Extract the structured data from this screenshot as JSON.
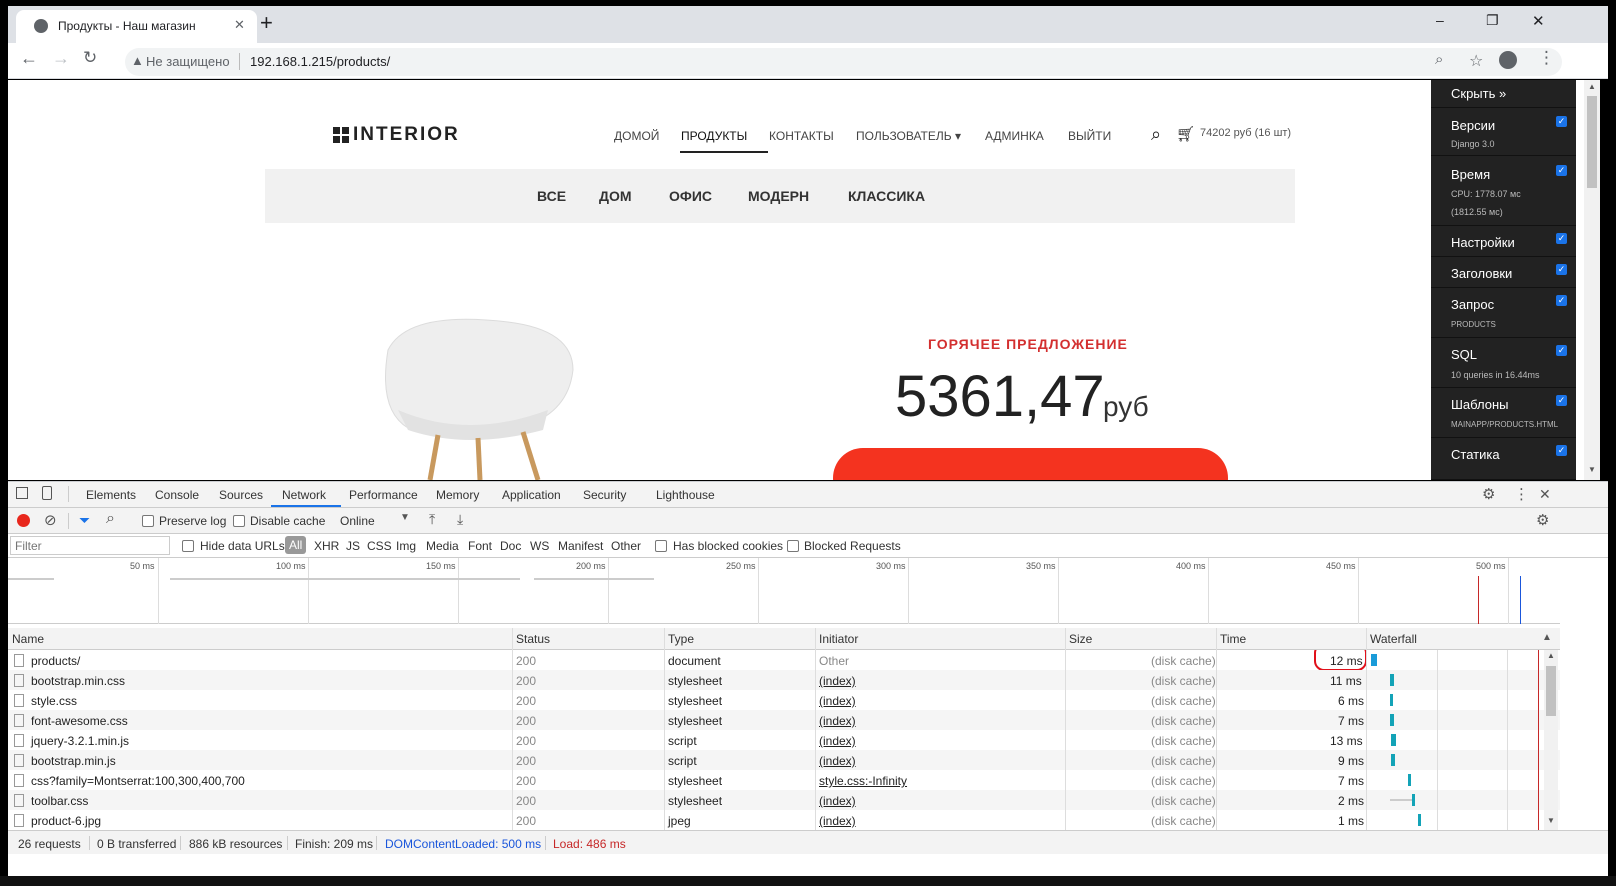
{
  "browser": {
    "tab_title": "Продукты - Наш магазин",
    "new_tab": "+",
    "security_label": "Не защищено",
    "url": "192.168.1.215/products/",
    "window_minimize": "–",
    "window_restore": "❐",
    "window_close": "✕"
  },
  "site": {
    "logo_text": "INTERIOR",
    "nav": [
      "ДОМОЙ",
      "ПРОДУКТЫ",
      "КОНТАКТЫ",
      "ПОЛЬЗОВАТЕЛЬ ▾",
      "АДМИНКА",
      "ВЫЙТИ"
    ],
    "active_nav": "ПРОДУКТЫ",
    "cart": "74202 руб (16 шт)",
    "categories": [
      "ВСЕ",
      "ДОМ",
      "ОФИС",
      "МОДЕРН",
      "КЛАССИКА"
    ],
    "hot_offer": "ГОРЯЧЕЕ ПРЕДЛОЖЕНИЕ",
    "price": "5361,47",
    "price_currency": "руб"
  },
  "debug_toolbar": {
    "hide": "Скрыть »",
    "panels": [
      {
        "label": "Версии",
        "sub": "Django 3.0"
      },
      {
        "label": "Время",
        "sub": "CPU: 1778.07 мс",
        "sub2": "(1812.55 мс)"
      },
      {
        "label": "Настройки",
        "sub": ""
      },
      {
        "label": "Заголовки",
        "sub": ""
      },
      {
        "label": "Запрос",
        "sub": "products"
      },
      {
        "label": "SQL",
        "sub": "10 queries in 16.44ms"
      },
      {
        "label": "Шаблоны",
        "sub": "mainapp/products.html"
      },
      {
        "label": "Статика",
        "sub": ""
      }
    ]
  },
  "devtools": {
    "tabs": [
      "Elements",
      "Console",
      "Sources",
      "Network",
      "Performance",
      "Memory",
      "Application",
      "Security",
      "Lighthouse"
    ],
    "active_tab": "Network",
    "preserve_log": "Preserve log",
    "disable_cache": "Disable cache",
    "throttling": "Online",
    "filter_placeholder": "Filter",
    "hide_data_urls": "Hide data URLs",
    "types": [
      "All",
      "XHR",
      "JS",
      "CSS",
      "Img",
      "Media",
      "Font",
      "Doc",
      "WS",
      "Manifest",
      "Other"
    ],
    "has_blocked_cookies": "Has blocked cookies",
    "blocked_requests": "Blocked Requests",
    "overview_ticks": [
      "50 ms",
      "100 ms",
      "150 ms",
      "200 ms",
      "250 ms",
      "300 ms",
      "350 ms",
      "400 ms",
      "450 ms",
      "500 ms"
    ],
    "columns": [
      "Name",
      "Status",
      "Type",
      "Initiator",
      "Size",
      "Time",
      "Waterfall"
    ],
    "rows": [
      {
        "name": "products/",
        "status": "200",
        "type": "document",
        "initiator": "Other",
        "size": "(disk cache)",
        "time": "12 ms"
      },
      {
        "name": "bootstrap.min.css",
        "status": "200",
        "type": "stylesheet",
        "initiator": "(index)",
        "size": "(disk cache)",
        "time": "11 ms"
      },
      {
        "name": "style.css",
        "status": "200",
        "type": "stylesheet",
        "initiator": "(index)",
        "size": "(disk cache)",
        "time": "6 ms"
      },
      {
        "name": "font-awesome.css",
        "status": "200",
        "type": "stylesheet",
        "initiator": "(index)",
        "size": "(disk cache)",
        "time": "7 ms"
      },
      {
        "name": "jquery-3.2.1.min.js",
        "status": "200",
        "type": "script",
        "initiator": "(index)",
        "size": "(disk cache)",
        "time": "13 ms"
      },
      {
        "name": "bootstrap.min.js",
        "status": "200",
        "type": "script",
        "initiator": "(index)",
        "size": "(disk cache)",
        "time": "9 ms"
      },
      {
        "name": "css?family=Montserrat:100,300,400,700",
        "status": "200",
        "type": "stylesheet",
        "initiator": "style.css:-Infinity",
        "size": "(disk cache)",
        "time": "7 ms"
      },
      {
        "name": "toolbar.css",
        "status": "200",
        "type": "stylesheet",
        "initiator": "(index)",
        "size": "(disk cache)",
        "time": "2 ms"
      },
      {
        "name": "product-6.jpg",
        "status": "200",
        "type": "jpeg",
        "initiator": "(index)",
        "size": "(disk cache)",
        "time": "1 ms"
      }
    ],
    "status_bar": {
      "requests": "26 requests",
      "transferred": "0 B transferred",
      "resources": "886 kB resources",
      "finish": "Finish: 209 ms",
      "dcl": "DOMContentLoaded: 500 ms",
      "load": "Load: 486 ms"
    }
  }
}
